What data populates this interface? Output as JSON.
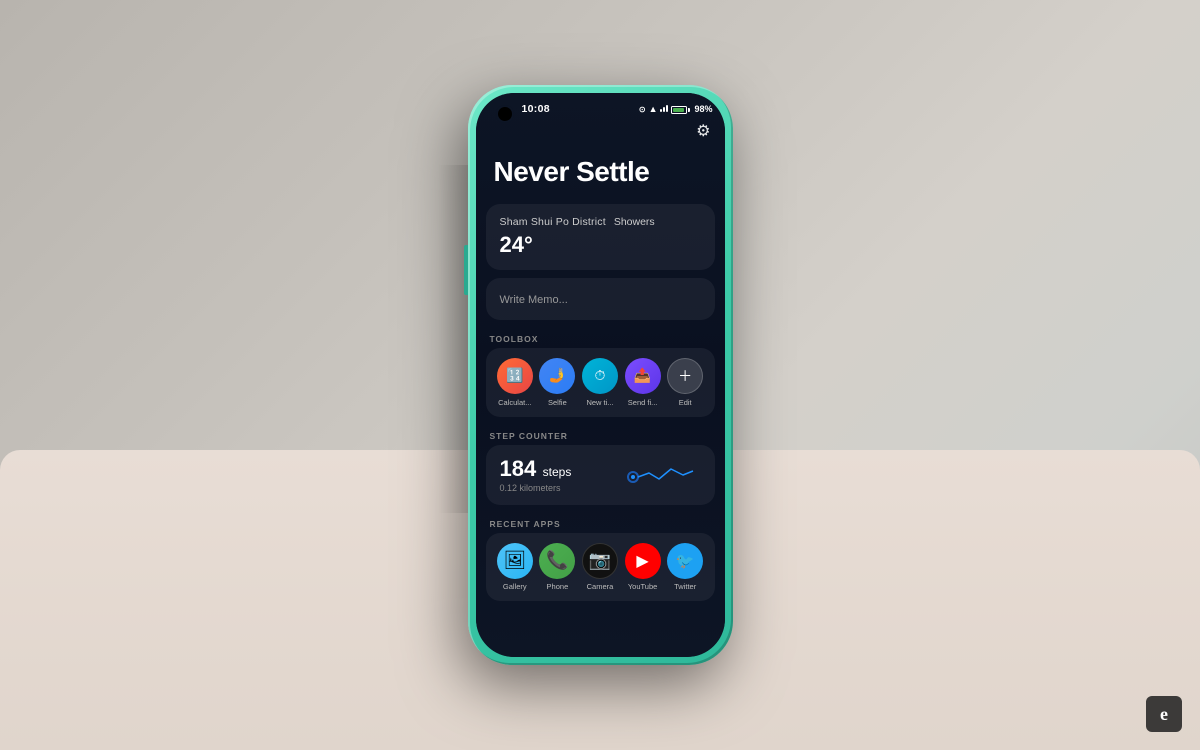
{
  "background": {
    "color": "#c4c0ba"
  },
  "phone": {
    "shell_color": "#3dcba8",
    "screen_bg": "#0d1525"
  },
  "status_bar": {
    "time": "10:08",
    "battery": "98%",
    "icons": [
      "location",
      "signal",
      "battery"
    ]
  },
  "header": {
    "tagline": "Never Settle"
  },
  "weather": {
    "location": "Sham Shui Po District",
    "condition": "Showers",
    "temperature": "24°"
  },
  "memo": {
    "placeholder": "Write Memo..."
  },
  "toolbox": {
    "label": "TOOLBOX",
    "apps": [
      {
        "name": "Calculat...",
        "icon_type": "calc"
      },
      {
        "name": "Selfie",
        "icon_type": "selfie"
      },
      {
        "name": "New ti...",
        "icon_type": "timer"
      },
      {
        "name": "Send fi...",
        "icon_type": "send"
      },
      {
        "name": "Edit",
        "icon_type": "edit"
      }
    ]
  },
  "step_counter": {
    "label": "STEP COUNTER",
    "steps": "184",
    "steps_unit": "steps",
    "distance": "0.12 kilometers"
  },
  "recent_apps": {
    "label": "RECENT APPS",
    "apps": [
      {
        "name": "Gallery",
        "icon_type": "gallery"
      },
      {
        "name": "Phone",
        "icon_type": "phone"
      },
      {
        "name": "Camera",
        "icon_type": "camera"
      },
      {
        "name": "YouTube",
        "icon_type": "youtube"
      },
      {
        "name": "Twitter",
        "icon_type": "twitter"
      }
    ]
  },
  "engadget": {
    "watermark": "e"
  }
}
